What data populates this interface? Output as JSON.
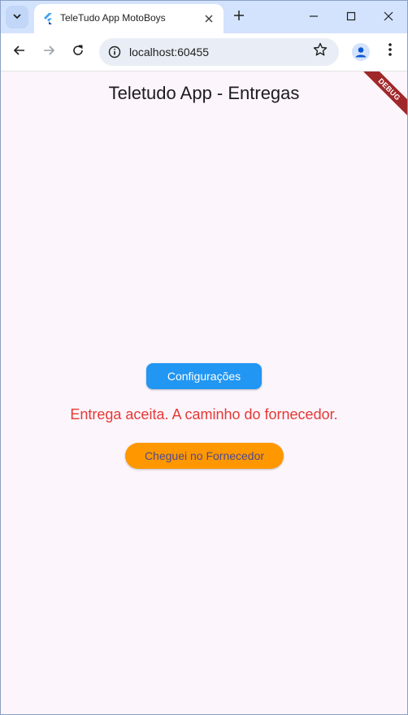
{
  "browser": {
    "tab_title": "TeleTudo App MotoBoys",
    "url": "localhost:60455",
    "tab_search_icon": "chevron-down-icon",
    "close_tab_icon": "close-icon",
    "new_tab_icon": "plus-icon"
  },
  "app": {
    "title": "Teletudo App - Entregas",
    "debug_banner": "DEBUG",
    "config_button": "Configurações",
    "status_message": "Entrega aceita. A caminho do fornecedor.",
    "arrived_button": "Cheguei no Fornecedor"
  },
  "colors": {
    "background": "#fcf5fc",
    "config_button": "#2196f3",
    "status_text": "#e53935",
    "arrived_button": "#ff9800",
    "debug_banner": "#a0282a"
  }
}
